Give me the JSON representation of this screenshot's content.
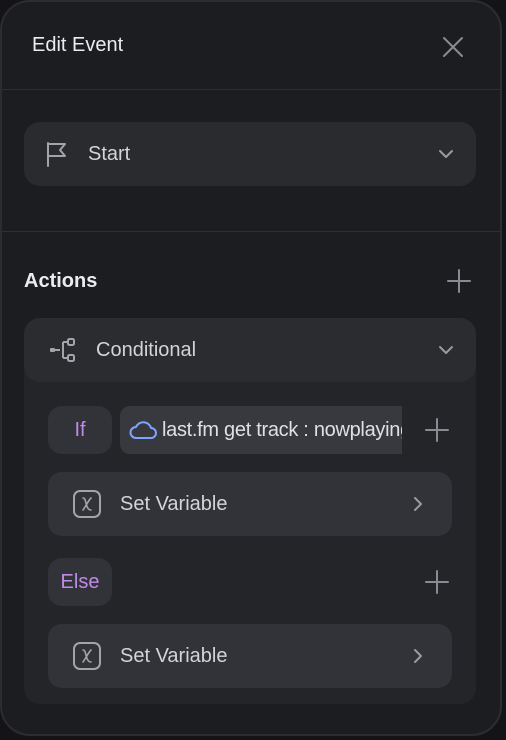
{
  "header": {
    "title": "Edit Event",
    "close_icon": "close-icon"
  },
  "trigger": {
    "selected": "Start",
    "icon": "flag-icon"
  },
  "actions": {
    "title": "Actions",
    "conditional": {
      "label": "Conditional",
      "icon": "branch-icon",
      "if_label": "If",
      "if_expression": "last.fm get track : nowplaying",
      "expression_icon": "cloud-icon",
      "if_action": {
        "label": "Set Variable",
        "icon": "variable-icon"
      },
      "else_label": "Else",
      "else_action": {
        "label": "Set Variable",
        "icon": "variable-icon"
      }
    }
  },
  "colors": {
    "panel": "#1c1d20",
    "card": "#2a2b2f",
    "keyword": "#c08be8",
    "cloud_icon": "#7aa6ff"
  }
}
